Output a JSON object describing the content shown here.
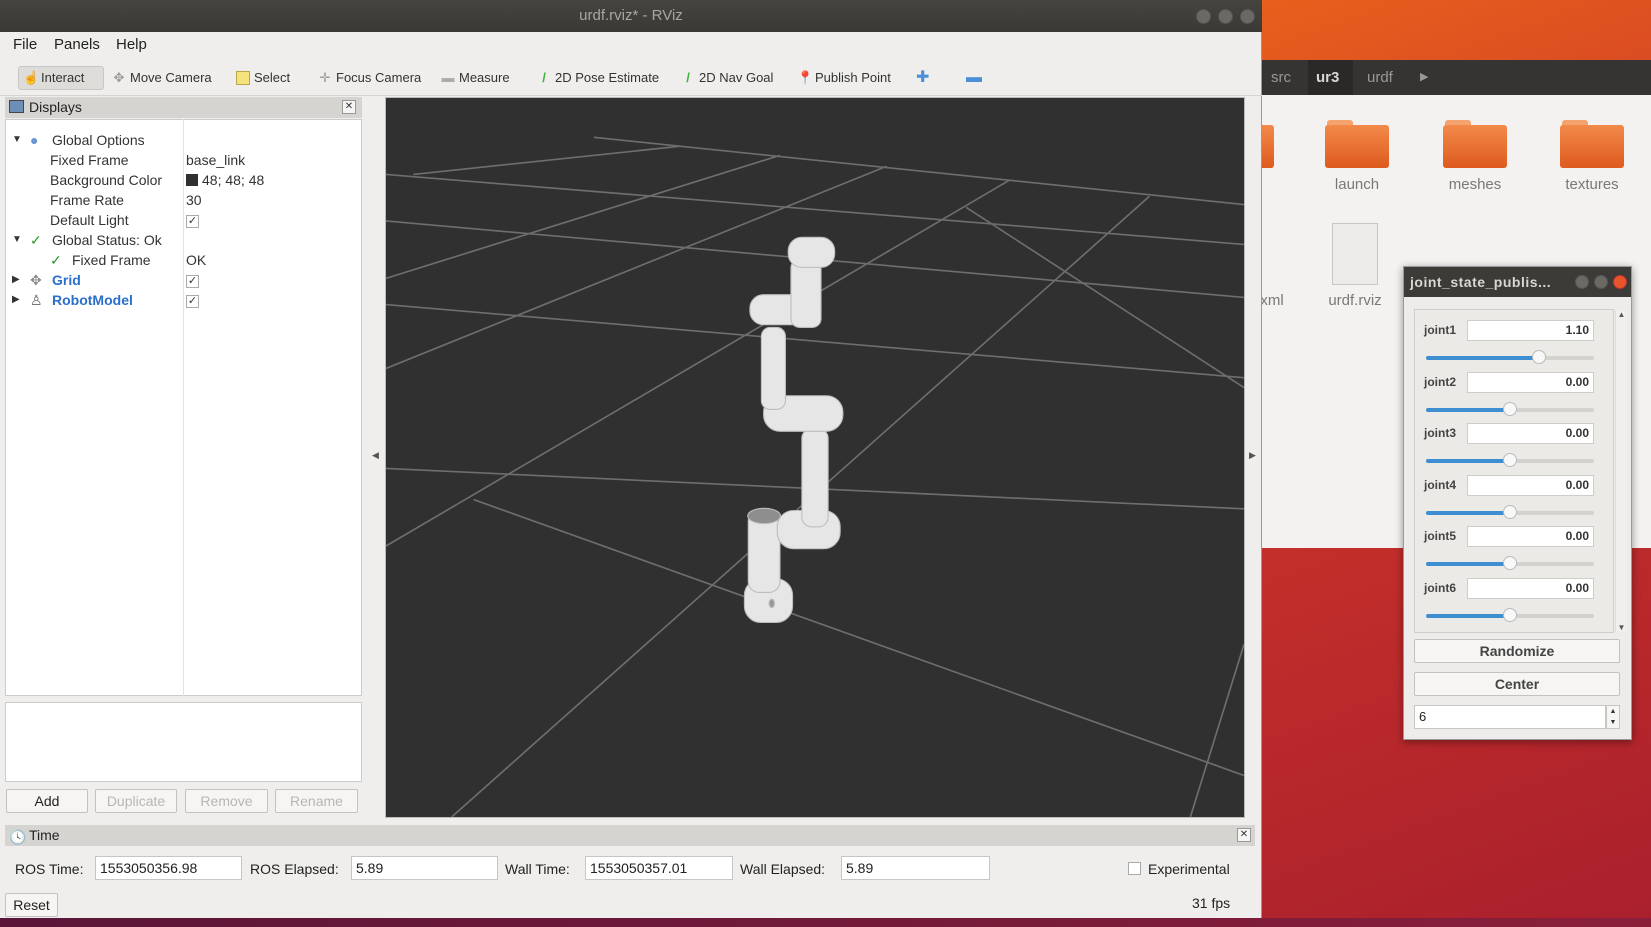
{
  "rviz": {
    "title": "urdf.rviz* - RViz",
    "menu": [
      "File",
      "Panels",
      "Help"
    ],
    "toolbar": [
      {
        "label": "Interact",
        "icon": "hand-icon",
        "active": true
      },
      {
        "label": "Move Camera",
        "icon": "move-camera-icon"
      },
      {
        "label": "Select",
        "icon": "select-icon"
      },
      {
        "label": "Focus Camera",
        "icon": "focus-camera-icon"
      },
      {
        "label": "Measure",
        "icon": "ruler-icon"
      },
      {
        "label": "2D Pose Estimate",
        "icon": "green-arrow-icon"
      },
      {
        "label": "2D Nav Goal",
        "icon": "green-arrow-icon"
      },
      {
        "label": "Publish Point",
        "icon": "map-pin-icon"
      }
    ],
    "displays": {
      "title": "Displays",
      "rows": [
        {
          "label": "Global Options",
          "value": ""
        },
        {
          "label": "Fixed Frame",
          "value": "base_link"
        },
        {
          "label": "Background Color",
          "value": "48; 48; 48",
          "color": "#303030"
        },
        {
          "label": "Frame Rate",
          "value": "30"
        },
        {
          "label": "Default Light",
          "checked": true
        },
        {
          "label": "Global Status: Ok",
          "value": ""
        },
        {
          "label": "Fixed Frame",
          "value": "OK"
        },
        {
          "label": "Grid",
          "checked": true
        },
        {
          "label": "RobotModel",
          "checked": true
        }
      ],
      "buttons": {
        "add": "Add",
        "duplicate": "Duplicate",
        "remove": "Remove",
        "rename": "Rename"
      }
    },
    "time": {
      "title": "Time",
      "ros_time_label": "ROS Time:",
      "ros_time": "1553050356.98",
      "ros_elapsed_label": "ROS Elapsed:",
      "ros_elapsed": "5.89",
      "wall_time_label": "Wall Time:",
      "wall_time": "1553050357.01",
      "wall_elapsed_label": "Wall Elapsed:",
      "wall_elapsed": "5.89",
      "experimental_label": "Experimental",
      "experimental_checked": false,
      "reset": "Reset",
      "fps": "31 fps"
    }
  },
  "file_manager": {
    "breadcrumbs": [
      "src",
      "ur3",
      "urdf"
    ],
    "active_crumb": "ur3",
    "items": [
      {
        "name": "launch",
        "type": "folder"
      },
      {
        "name": "meshes",
        "type": "folder"
      },
      {
        "name": "textures",
        "type": "folder"
      },
      {
        "name": "urdf.rviz",
        "type": "file"
      }
    ],
    "partial_item": "xml"
  },
  "joint_state_publisher": {
    "title": "joint_state_publis...",
    "joints": [
      {
        "name": "joint1",
        "value": "1.10",
        "slider_fraction": 0.67
      },
      {
        "name": "joint2",
        "value": "0.00",
        "slider_fraction": 0.5
      },
      {
        "name": "joint3",
        "value": "0.00",
        "slider_fraction": 0.5
      },
      {
        "name": "joint4",
        "value": "0.00",
        "slider_fraction": 0.5
      },
      {
        "name": "joint5",
        "value": "0.00",
        "slider_fraction": 0.5
      },
      {
        "name": "joint6",
        "value": "0.00",
        "slider_fraction": 0.5
      }
    ],
    "randomize": "Randomize",
    "center": "Center",
    "spin_value": "6"
  },
  "colors": {
    "slider": "#3d8fd1",
    "desktop": "#e05a1c",
    "folder": "#e8722f",
    "link_blue": "#2a6fc9"
  }
}
